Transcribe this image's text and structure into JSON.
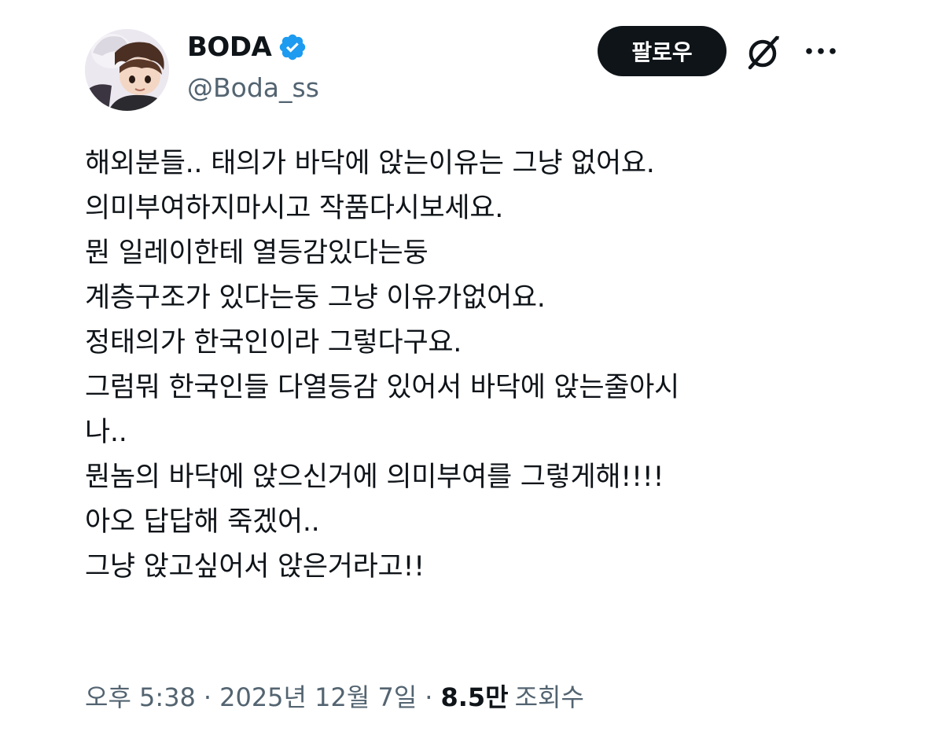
{
  "author": {
    "display_name": "BODA",
    "handle": "@Boda_ss",
    "verified": true,
    "verified_color": "#1d9bf0"
  },
  "actions": {
    "follow_label": "팔로우",
    "grok_icon": "grok-icon",
    "more_icon": "more-options-icon"
  },
  "tweet": {
    "lines": [
      "해외분들.. 태의가 바닥에 앉는이유는 그냥 없어요.",
      "의미부여하지마시고 작품다시보세요.",
      "뭔 일레이한테 열등감있다는둥",
      "계층구조가 있다는둥 그냥 이유가없어요.",
      "정태의가 한국인이라 그렇다구요.",
      "그럼뭐 한국인들 다열등감 있어서 바닥에 앉는줄아시",
      "나..",
      "뭔놈의 바닥에 앉으신거에 의미부여를 그렇게해!!!!",
      "아오 답답해 죽겠어..",
      "그냥 앉고싶어서 앉은거라고!!"
    ]
  },
  "meta": {
    "time": "오후 5:38",
    "separator": "·",
    "date": "2025년 12월 7일",
    "views_count": "8.5만",
    "views_label": "조회수"
  },
  "colors": {
    "text_primary": "#0f1419",
    "text_secondary": "#536471",
    "button_bg": "#0f1419",
    "button_text": "#ffffff"
  }
}
